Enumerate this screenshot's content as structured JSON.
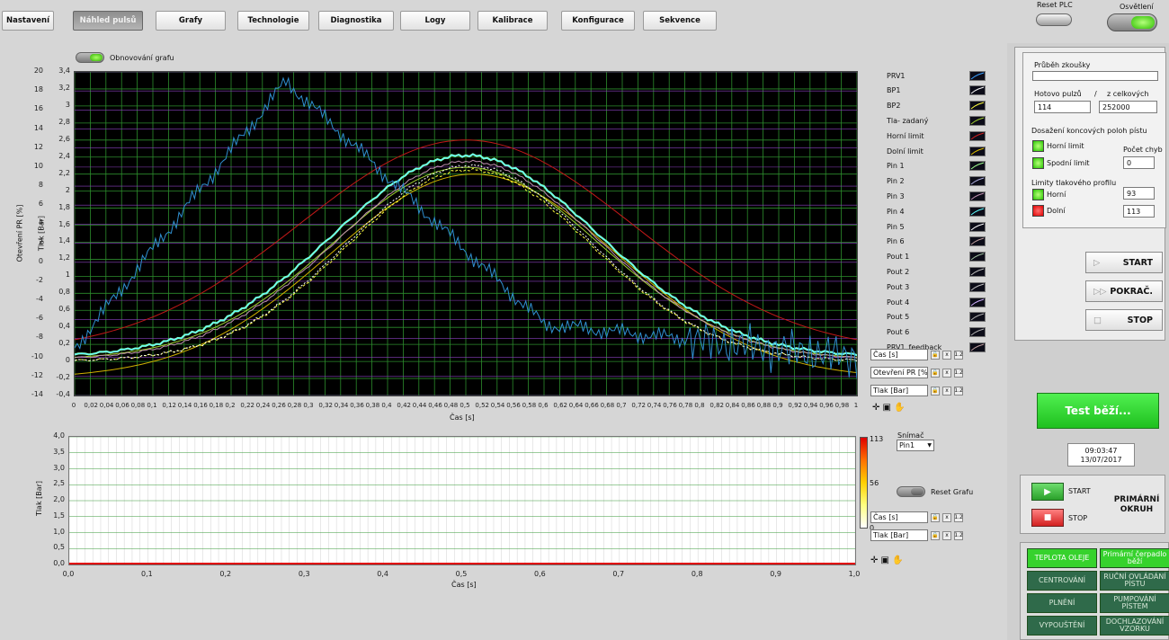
{
  "tabs": [
    {
      "label": "Nastavení",
      "active": false
    },
    {
      "label": "Náhled pulsů",
      "active": true
    },
    {
      "label": "Grafy",
      "active": false
    },
    {
      "label": "Technologie",
      "active": false
    },
    {
      "label": "Diagnostika",
      "active": false
    },
    {
      "label": "Logy",
      "active": false
    },
    {
      "label": "Kalibrace",
      "active": false
    },
    {
      "label": "Konfigurace",
      "active": false
    },
    {
      "label": "Sekvence",
      "active": false
    }
  ],
  "header": {
    "reset_plc": "Reset PLC",
    "osvetleni": "Osvětlení"
  },
  "graph1": {
    "refresh_toggle": "Obnovování grafu",
    "ylabel_left": "Otevření PR [%]",
    "ylabel_right": "Tlak [Bar]",
    "xlabel": "Čas [s]",
    "yticks_left": [
      "20",
      "18",
      "16",
      "14",
      "12",
      "10",
      "8",
      "6",
      "4",
      "2",
      "0",
      "-2",
      "-4",
      "-6",
      "-8",
      "-10",
      "-12",
      "-14"
    ],
    "yticks_right": [
      "3,4",
      "3,2",
      "3",
      "2,8",
      "2,6",
      "2,4",
      "2,2",
      "2",
      "1,8",
      "1,6",
      "1,4",
      "1,2",
      "1",
      "0,8",
      "0,6",
      "0,4",
      "0,2",
      "0",
      "-0,2",
      "-0,4"
    ],
    "xticks": [
      "0",
      "0,02",
      "0,04",
      "0,06",
      "0,08",
      "0,1",
      "0,12",
      "0,14",
      "0,16",
      "0,18",
      "0,2",
      "0,22",
      "0,24",
      "0,26",
      "0,28",
      "0,3",
      "0,32",
      "0,34",
      "0,36",
      "0,38",
      "0,4",
      "0,42",
      "0,44",
      "0,46",
      "0,48",
      "0,5",
      "0,52",
      "0,54",
      "0,56",
      "0,58",
      "0,6",
      "0,62",
      "0,64",
      "0,66",
      "0,68",
      "0,7",
      "0,72",
      "0,74",
      "0,76",
      "0,78",
      "0,8",
      "0,82",
      "0,84",
      "0,86",
      "0,88",
      "0,9",
      "0,92",
      "0,94",
      "0,96",
      "0,98",
      "1"
    ],
    "legend": [
      {
        "name": "PRV1",
        "color": "#3aa0ff"
      },
      {
        "name": "BP1",
        "color": "#ffffff"
      },
      {
        "name": "BP2",
        "color": "#ffff40"
      },
      {
        "name": "Tla- zadaný",
        "color": "#a0d030"
      },
      {
        "name": "Horní limit",
        "color": "#d02020"
      },
      {
        "name": "Dolní limit",
        "color": "#e0c000"
      },
      {
        "name": "Pin 1",
        "color": "#a0ff90"
      },
      {
        "name": "Pin 2",
        "color": "#b0b0e0"
      },
      {
        "name": "Pin 3",
        "color": "#c090b0"
      },
      {
        "name": "Pin 4",
        "color": "#60ffff"
      },
      {
        "name": "Pin 5",
        "color": "#ffffff"
      },
      {
        "name": "Pin 6",
        "color": "#c0a0a0"
      },
      {
        "name": "Pout 1",
        "color": "#a0c0a0"
      },
      {
        "name": "Pout 2",
        "color": "#c0c0c0"
      },
      {
        "name": "Pout 3",
        "color": "#c0c0c0"
      },
      {
        "name": "Pout 4",
        "color": "#d0b0ff"
      },
      {
        "name": "Pout 5",
        "color": "#b0b0b0"
      },
      {
        "name": "Pout 6",
        "color": "#b0b0b0"
      },
      {
        "name": "PRV1_feedback",
        "color": "#c0a0a0"
      }
    ],
    "scales": [
      "Čas [s]",
      "Otevření PR [%]",
      "Tlak [Bar]"
    ]
  },
  "graph2": {
    "ylabel": "Tlak [Bar]",
    "xlabel": "Čas [s]",
    "yticks": [
      "4,0",
      "3,5",
      "3,0",
      "2,5",
      "2,0",
      "1,5",
      "1,0",
      "0,5",
      "0,0"
    ],
    "xticks": [
      "0,0",
      "0,1",
      "0,2",
      "0,3",
      "0,4",
      "0,5",
      "0,6",
      "0,7",
      "0,8",
      "0,9",
      "1,0"
    ],
    "colorbar": [
      "113",
      "56",
      "0"
    ],
    "snimac_label": "Snímač",
    "snimac_value": "Pin1",
    "reset_toggle": "Reset Grafu",
    "scales": [
      "Čas [s]",
      "Tlak  [Bar]"
    ]
  },
  "status": {
    "prubeh": "Průběh zkoušky",
    "hotovo": "Hotovo pulzů",
    "slash": "/",
    "celkovych": "z celkových",
    "hotovo_val": "114",
    "celkovych_val": "252000",
    "dosazeni": "Dosažení koncových poloh pístu",
    "horni_limit": "Horní limit",
    "spodni_limit": "Spodní limit",
    "pocet_chyb": "Počet chyb",
    "pocet_chyb_val": "0",
    "limity": "Limity tlakového profilu",
    "horni": "Horní",
    "horni_val": "93",
    "dolni": "Dolní",
    "dolni_val": "113"
  },
  "controls": {
    "start": "START",
    "pokrac": "POKRAČ.",
    "stop": "STOP"
  },
  "test_banner": "Test běží...",
  "datetime": {
    "time": "09:03:47",
    "date": "13/07/2017"
  },
  "primary": {
    "start": "START",
    "stop": "STOP",
    "label": "PRIMÁRNÍ OKRUH"
  },
  "bottom_buttons": [
    {
      "label": "TEPLOTA OLEJE",
      "style": "bright"
    },
    {
      "label": "Primární čerpadlo běží",
      "style": "bright"
    },
    {
      "label": "CENTROVÁNÍ",
      "style": "dark"
    },
    {
      "label": "RUČNÍ OVLÁDÁNÍ PÍSTU",
      "style": "dark"
    },
    {
      "label": "PLNĚNÍ",
      "style": "dark"
    },
    {
      "label": "PUMPOVÁNÍ PÍSTEM",
      "style": "dark"
    },
    {
      "label": "VYPOUŠTĚNÍ",
      "style": "dark"
    },
    {
      "label": "DOCHLAZOVÁNÍ VZORKU",
      "style": "dark"
    }
  ]
}
